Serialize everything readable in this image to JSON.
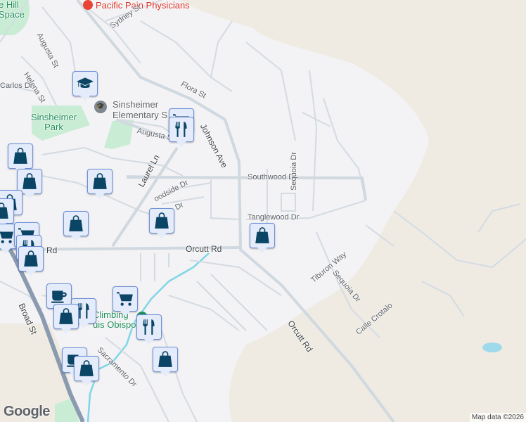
{
  "map": {
    "labels": {
      "hill_space": "e Hill\nSpace",
      "pacific_pain": "Pacific Pain Physicians",
      "sydney_st": "Sydney St",
      "augusta_st_n": "Augusta St",
      "helena_st": "Helena St",
      "carlos_dr": "Carlos Dr",
      "flora_st": "Flora St",
      "sinsheimer_elem": "Sinsheimer\nElementary S",
      "sinsheimer_park": "Sinsheimer\nPark",
      "augusta_st_s": "Augusta S",
      "johnson_ave": "Johnson Ave",
      "laurel_ln": "Laurel Ln",
      "southwood_dr": "Southwood Dr",
      "woodside_dr": "oodside Dr",
      "dr_short": "Dr",
      "sequoia_dr_n": "Sequoia Dr",
      "tanglewood_dr": "Tanglewood Dr",
      "orcutt_rd_w": "Rd",
      "orcutt_rd": "Orcutt Rd",
      "tiburon_way": "Tiburon Way",
      "sequoia_dr_s": "Sequoia Dr",
      "calle_crotalo": "Calle Crotalo",
      "orcutt_rd_diag": "Orcutt Rd",
      "broad_st": "Broad St",
      "climbing": "Climbing\nuis Obispo",
      "sacramento_dr": "Sacramento Dr"
    },
    "markers": [
      "school",
      "shopping",
      "restaurant",
      "bag",
      "bag",
      "bag",
      "bag",
      "bag",
      "bag",
      "bag",
      "bag",
      "shopping",
      "shopping",
      "restaurant",
      "bag",
      "cafe",
      "restaurant",
      "bag",
      "shopping",
      "restaurant",
      "bag",
      "cafe",
      "bag"
    ],
    "colors": {
      "background": "#f3f2f4",
      "terrain": "#efebe2",
      "park": "#c9ecd4",
      "road": "#d3dbe3",
      "highway": "#8a9bb0",
      "water": "#7fd6e8",
      "marker_fill": "#e4ecfb",
      "marker_icon": "#0b4565"
    }
  },
  "footer": {
    "logo": "Google",
    "attribution": "Map data ©2026"
  }
}
